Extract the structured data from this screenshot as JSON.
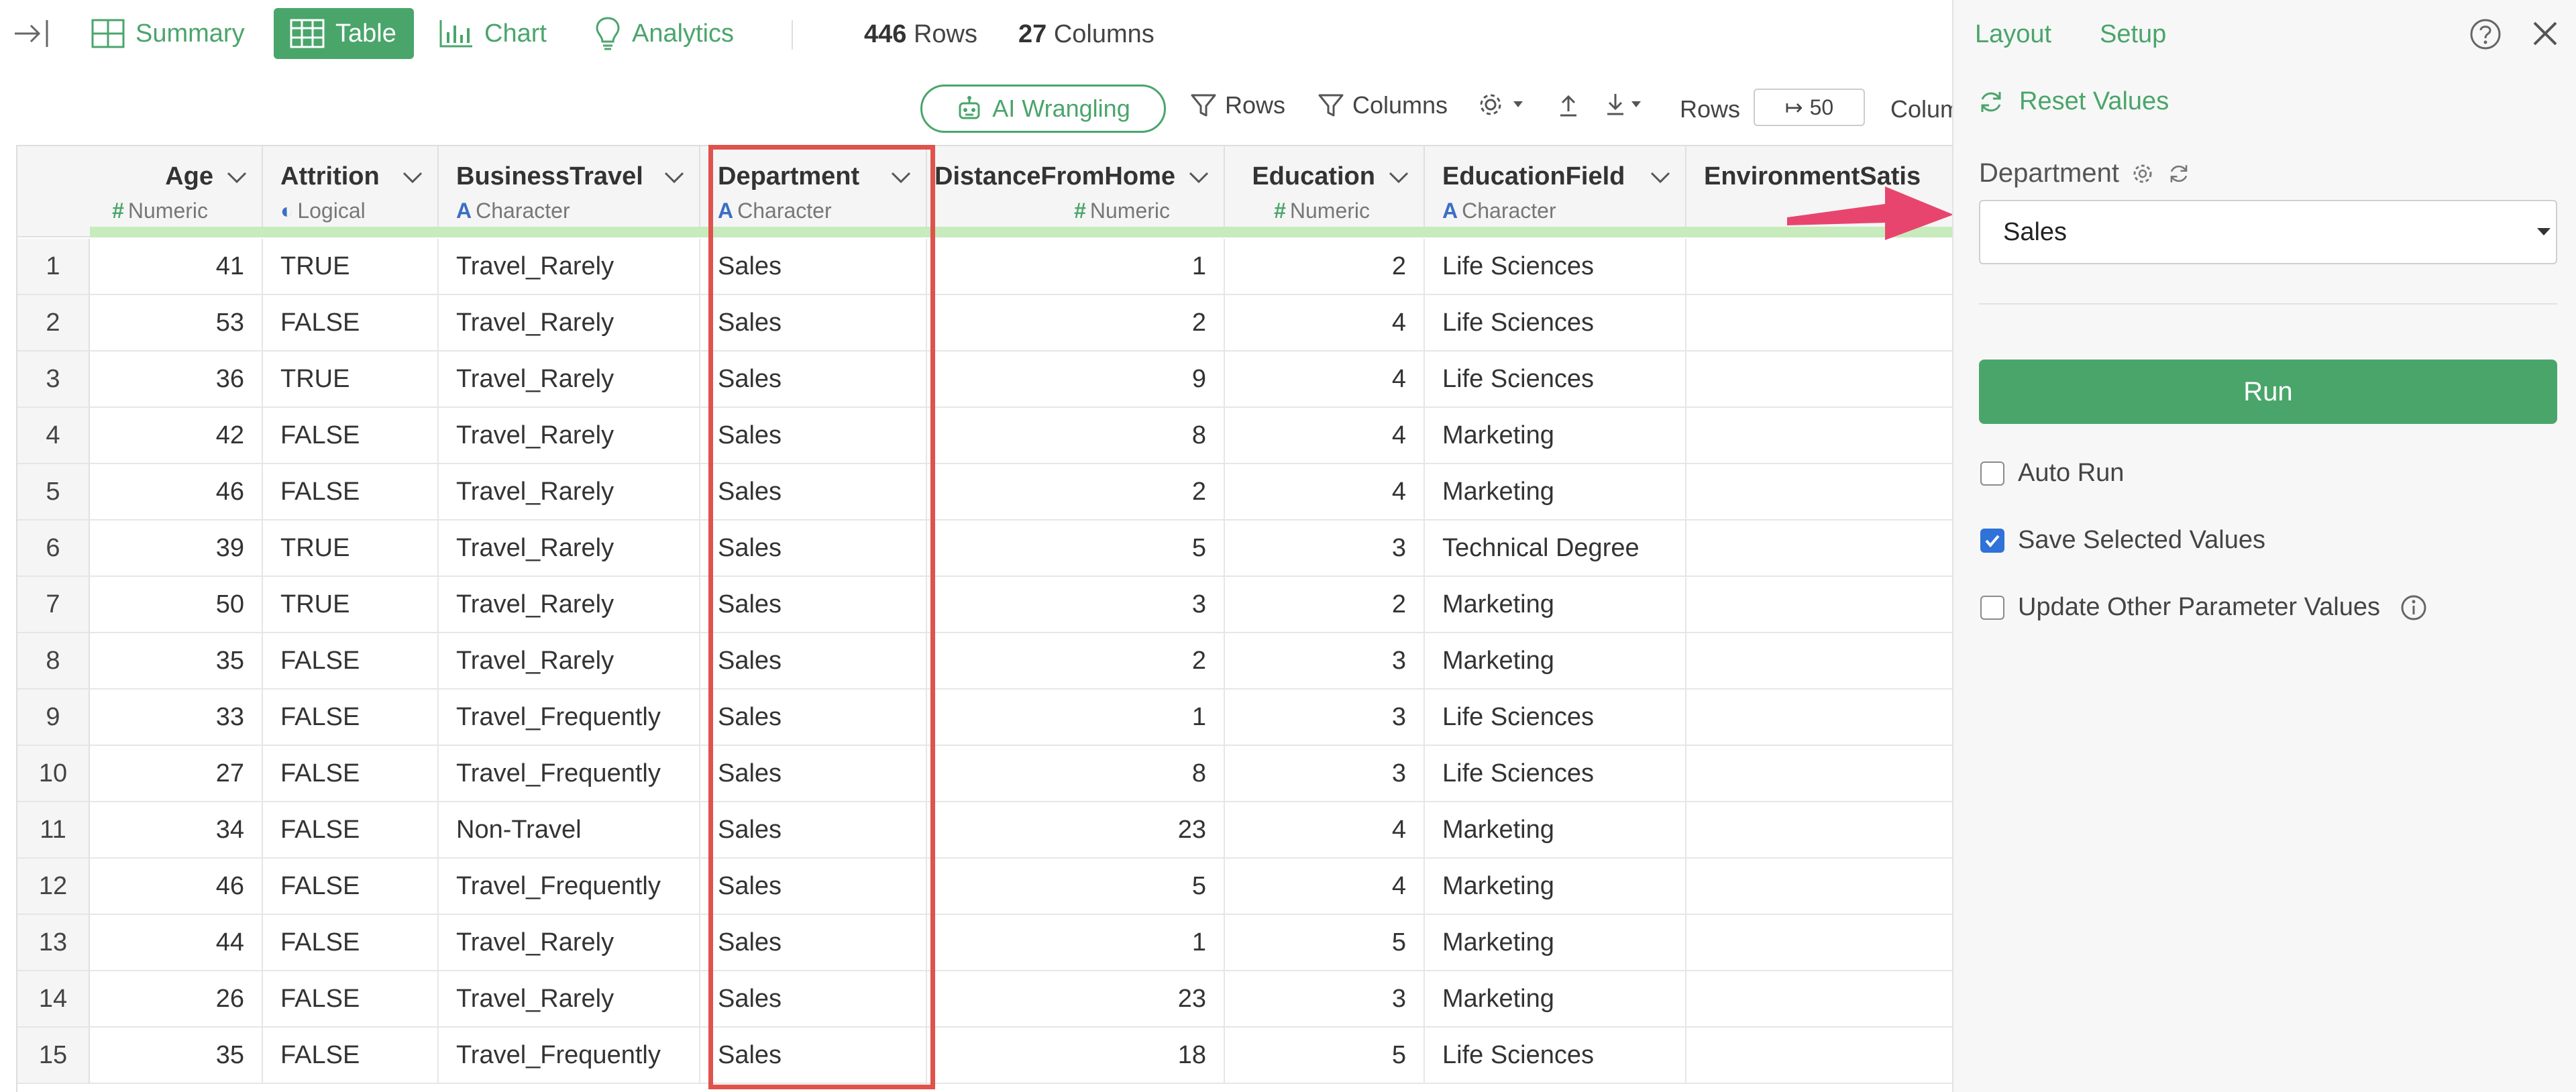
{
  "topbar": {
    "tabs": [
      {
        "label": "Summary",
        "icon": "summary-grid-icon"
      },
      {
        "label": "Table",
        "icon": "table-icon"
      },
      {
        "label": "Chart",
        "icon": "chart-icon"
      },
      {
        "label": "Analytics",
        "icon": "lightbulb-icon"
      }
    ],
    "active_tab": "Table",
    "rows_count": "446",
    "rows_word": "Rows",
    "cols_count": "27",
    "cols_word": "Columns"
  },
  "toolbar": {
    "ai_label": "AI Wrangling",
    "rows_filter": "Rows",
    "cols_filter": "Columns",
    "rows_label": "Rows",
    "rows_value": "50",
    "cols_label": "Colum"
  },
  "table": {
    "columns": [
      {
        "name": "Age",
        "type": "Numeric",
        "glyph": "#"
      },
      {
        "name": "Attrition",
        "type": "Logical",
        "glyph": "◐"
      },
      {
        "name": "BusinessTravel",
        "type": "Character",
        "glyph": "A"
      },
      {
        "name": "Department",
        "type": "Character",
        "glyph": "A"
      },
      {
        "name": "DistanceFromHome",
        "type": "Numeric",
        "glyph": "#"
      },
      {
        "name": "Education",
        "type": "Numeric",
        "glyph": "#"
      },
      {
        "name": "EducationField",
        "type": "Character",
        "glyph": "A"
      },
      {
        "name": "EnvironmentSatis",
        "type": "",
        "glyph": ""
      }
    ],
    "rows": [
      {
        "n": "1",
        "age": "41",
        "attr": "TRUE",
        "travel": "Travel_Rarely",
        "dept": "Sales",
        "dist": "1",
        "edu": "2",
        "field": "Life Sciences"
      },
      {
        "n": "2",
        "age": "53",
        "attr": "FALSE",
        "travel": "Travel_Rarely",
        "dept": "Sales",
        "dist": "2",
        "edu": "4",
        "field": "Life Sciences"
      },
      {
        "n": "3",
        "age": "36",
        "attr": "TRUE",
        "travel": "Travel_Rarely",
        "dept": "Sales",
        "dist": "9",
        "edu": "4",
        "field": "Life Sciences"
      },
      {
        "n": "4",
        "age": "42",
        "attr": "FALSE",
        "travel": "Travel_Rarely",
        "dept": "Sales",
        "dist": "8",
        "edu": "4",
        "field": "Marketing"
      },
      {
        "n": "5",
        "age": "46",
        "attr": "FALSE",
        "travel": "Travel_Rarely",
        "dept": "Sales",
        "dist": "2",
        "edu": "4",
        "field": "Marketing"
      },
      {
        "n": "6",
        "age": "39",
        "attr": "TRUE",
        "travel": "Travel_Rarely",
        "dept": "Sales",
        "dist": "5",
        "edu": "3",
        "field": "Technical Degree"
      },
      {
        "n": "7",
        "age": "50",
        "attr": "TRUE",
        "travel": "Travel_Rarely",
        "dept": "Sales",
        "dist": "3",
        "edu": "2",
        "field": "Marketing"
      },
      {
        "n": "8",
        "age": "35",
        "attr": "FALSE",
        "travel": "Travel_Rarely",
        "dept": "Sales",
        "dist": "2",
        "edu": "3",
        "field": "Marketing"
      },
      {
        "n": "9",
        "age": "33",
        "attr": "FALSE",
        "travel": "Travel_Frequently",
        "dept": "Sales",
        "dist": "1",
        "edu": "3",
        "field": "Life Sciences"
      },
      {
        "n": "10",
        "age": "27",
        "attr": "FALSE",
        "travel": "Travel_Frequently",
        "dept": "Sales",
        "dist": "8",
        "edu": "3",
        "field": "Life Sciences"
      },
      {
        "n": "11",
        "age": "34",
        "attr": "FALSE",
        "travel": "Non-Travel",
        "dept": "Sales",
        "dist": "23",
        "edu": "4",
        "field": "Marketing"
      },
      {
        "n": "12",
        "age": "46",
        "attr": "FALSE",
        "travel": "Travel_Frequently",
        "dept": "Sales",
        "dist": "5",
        "edu": "4",
        "field": "Marketing"
      },
      {
        "n": "13",
        "age": "44",
        "attr": "FALSE",
        "travel": "Travel_Rarely",
        "dept": "Sales",
        "dist": "1",
        "edu": "5",
        "field": "Marketing"
      },
      {
        "n": "14",
        "age": "26",
        "attr": "FALSE",
        "travel": "Travel_Rarely",
        "dept": "Sales",
        "dist": "23",
        "edu": "3",
        "field": "Marketing"
      },
      {
        "n": "15",
        "age": "35",
        "attr": "FALSE",
        "travel": "Travel_Frequently",
        "dept": "Sales",
        "dist": "18",
        "edu": "5",
        "field": "Life Sciences"
      }
    ]
  },
  "panel": {
    "tabs": [
      "Layout",
      "Setup"
    ],
    "reset_label": "Reset Values",
    "param_label": "Department",
    "selected_value": "Sales",
    "run_label": "Run",
    "auto_run_label": "Auto Run",
    "auto_run_checked": false,
    "save_values_label": "Save Selected Values",
    "save_values_checked": true,
    "update_other_label": "Update Other Parameter Values",
    "update_other_checked": false
  },
  "colors": {
    "accent": "#4aa56b",
    "highlight": "#e0524c",
    "arrow": "#e8456e",
    "checkbox": "#2f72d8"
  }
}
